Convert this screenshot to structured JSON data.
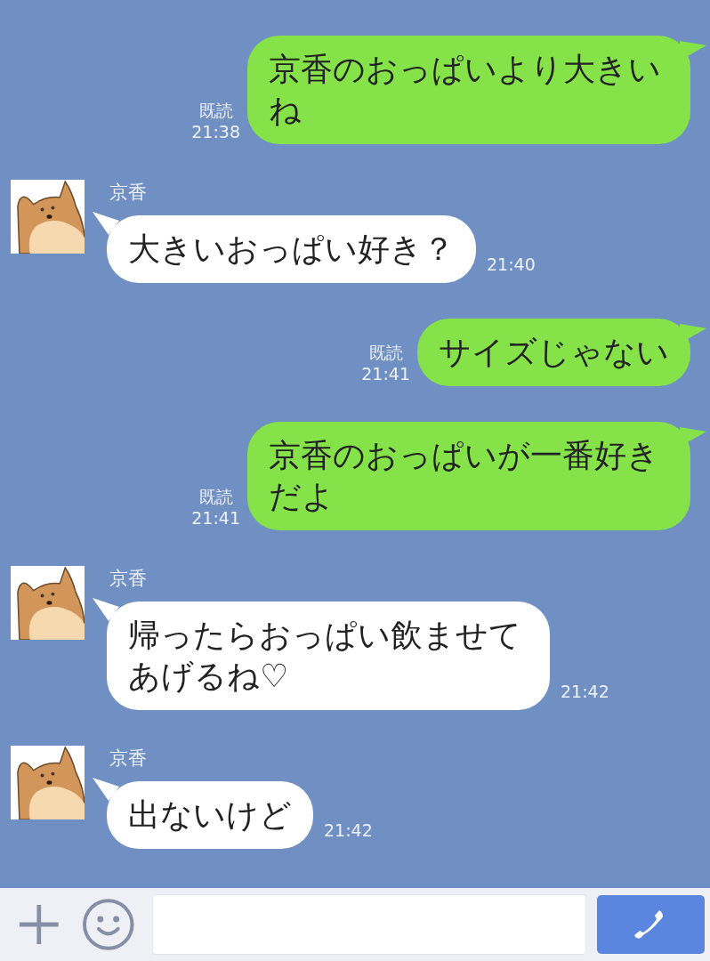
{
  "messages": [
    {
      "kind": "sent",
      "text": "京香のおっぱいより大きいね",
      "read": "既読",
      "time": "21:38"
    },
    {
      "kind": "received",
      "name": "京香",
      "text": "大きいおっぱい好き？",
      "time": "21:40"
    },
    {
      "kind": "sent",
      "text": "サイズじゃない",
      "read": "既読",
      "time": "21:41"
    },
    {
      "kind": "sent",
      "text": "京香のおっぱいが一番好きだよ",
      "read": "既読",
      "time": "21:41"
    },
    {
      "kind": "received",
      "name": "京香",
      "text": "帰ったらおっぱい飲ませてあげるね♡",
      "time": "21:42"
    },
    {
      "kind": "received",
      "name": "京香",
      "text": "出ないけど",
      "time": "21:42"
    }
  ]
}
